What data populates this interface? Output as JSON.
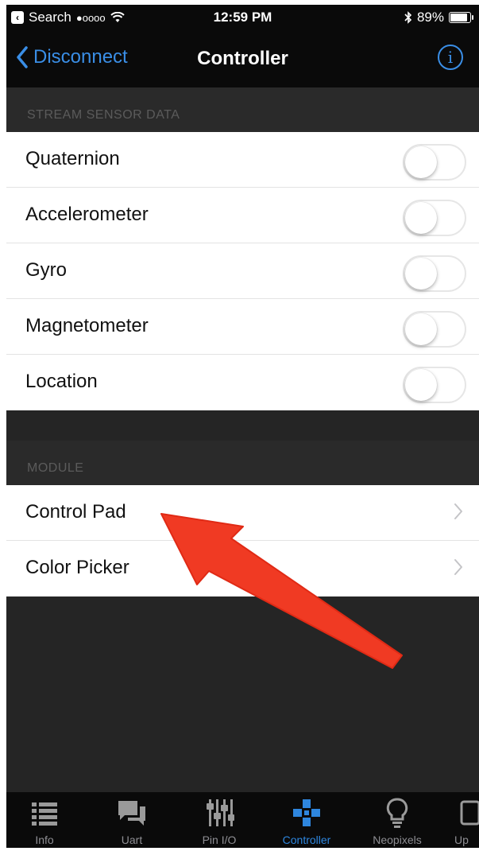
{
  "status_bar": {
    "back_app": "Search",
    "signal": "●oooo",
    "time": "12:59 PM",
    "battery_text": "89%",
    "battery_level": 0.89
  },
  "nav": {
    "back_label": "Disconnect",
    "title": "Controller",
    "info_glyph": "i"
  },
  "sections": {
    "stream": {
      "header": "STREAM SENSOR DATA",
      "items": [
        {
          "label": "Quaternion",
          "on": false
        },
        {
          "label": "Accelerometer",
          "on": false
        },
        {
          "label": "Gyro",
          "on": false
        },
        {
          "label": "Magnetometer",
          "on": false
        },
        {
          "label": "Location",
          "on": false
        }
      ]
    },
    "module": {
      "header": "MODULE",
      "items": [
        {
          "label": "Control Pad"
        },
        {
          "label": "Color Picker"
        }
      ]
    }
  },
  "tabs": [
    {
      "label": "Info",
      "icon": "list-icon",
      "active": false
    },
    {
      "label": "Uart",
      "icon": "chat-bubbles-icon",
      "active": false
    },
    {
      "label": "Pin I/O",
      "icon": "sliders-icon",
      "active": false
    },
    {
      "label": "Controller",
      "icon": "gamepad-icon",
      "active": true
    },
    {
      "label": "Neopixels",
      "icon": "lightbulb-icon",
      "active": false
    },
    {
      "label": "Up",
      "icon": "update-icon",
      "active": false
    }
  ],
  "colors": {
    "accent": "#3a8ee6",
    "active_tab": "#2e86de",
    "annotation_arrow": "#f03a23"
  }
}
